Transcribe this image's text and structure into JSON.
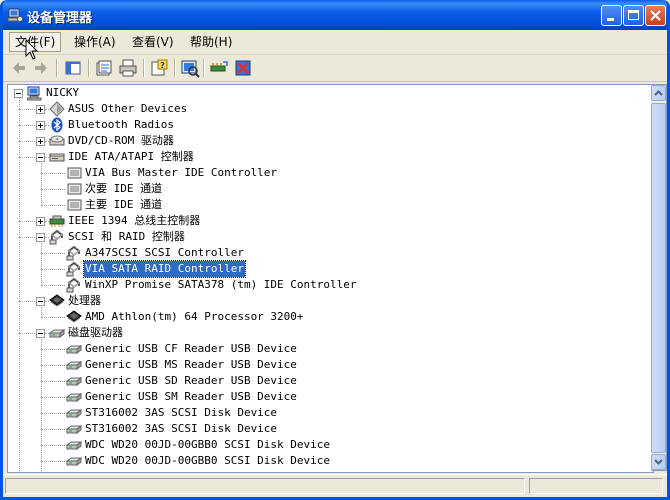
{
  "window": {
    "title": "设备管理器"
  },
  "menu": [
    {
      "label": "文件(F)",
      "active": true
    },
    {
      "label": "操作(A)"
    },
    {
      "label": "查看(V)"
    },
    {
      "label": "帮助(H)"
    }
  ],
  "toolbar": {
    "icons": [
      "back-icon",
      "forward-icon",
      "show-hide-console-tree-icon",
      "properties-icon",
      "print-icon",
      "help-icon",
      "scan-hardware-icon",
      "update-driver-icon",
      "uninstall-icon"
    ]
  },
  "tree": {
    "root": "NICKY",
    "items": [
      {
        "label": "ASUS Other Devices",
        "icon": "other-devices-icon",
        "level": 1,
        "expander": "plus"
      },
      {
        "label": "Bluetooth Radios",
        "icon": "bluetooth-icon",
        "level": 1,
        "expander": "plus"
      },
      {
        "label": "DVD/CD-ROM 驱动器",
        "icon": "cdrom-icon",
        "level": 1,
        "expander": "plus"
      },
      {
        "label": "IDE ATA/ATAPI 控制器",
        "icon": "ide-controller-icon",
        "level": 1,
        "expander": "minus"
      },
      {
        "label": "VIA Bus Master IDE Controller",
        "icon": "ide-channel-icon",
        "level": 2
      },
      {
        "label": "次要 IDE 通道",
        "icon": "ide-channel-icon",
        "level": 2
      },
      {
        "label": "主要 IDE 通道",
        "icon": "ide-channel-icon",
        "level": 2
      },
      {
        "label": "IEEE 1394 总线主控制器",
        "icon": "ieee1394-icon",
        "level": 1,
        "expander": "plus"
      },
      {
        "label": "SCSI 和 RAID 控制器",
        "icon": "scsi-icon",
        "level": 1,
        "expander": "minus"
      },
      {
        "label": "A347SCSI SCSI Controller",
        "icon": "scsi-icon",
        "level": 2
      },
      {
        "label": "VIA SATA RAID Controller",
        "icon": "scsi-icon",
        "level": 2,
        "selected": true
      },
      {
        "label": "WinXP Promise SATA378 (tm) IDE Controller",
        "icon": "scsi-icon",
        "level": 2
      },
      {
        "label": "处理器",
        "icon": "processor-icon",
        "level": 1,
        "expander": "minus"
      },
      {
        "label": "AMD Athlon(tm) 64 Processor 3200+",
        "icon": "processor-icon",
        "level": 2
      },
      {
        "label": "磁盘驱动器",
        "icon": "disk-drive-icon",
        "level": 1,
        "expander": "minus"
      },
      {
        "label": "Generic USB CF Reader USB Device",
        "icon": "disk-drive-icon",
        "level": 2
      },
      {
        "label": "Generic USB MS Reader USB Device",
        "icon": "disk-drive-icon",
        "level": 2
      },
      {
        "label": "Generic USB SD Reader USB Device",
        "icon": "disk-drive-icon",
        "level": 2
      },
      {
        "label": "Generic USB SM Reader USB Device",
        "icon": "disk-drive-icon",
        "level": 2
      },
      {
        "label": "ST316002 3AS SCSI Disk Device",
        "icon": "disk-drive-icon",
        "level": 2
      },
      {
        "label": "ST316002 3AS SCSI Disk Device",
        "icon": "disk-drive-icon",
        "level": 2
      },
      {
        "label": "WDC WD20 00JD-00GBB0 SCSI Disk Device",
        "icon": "disk-drive-icon",
        "level": 2
      },
      {
        "label": "WDC WD20 00JD-00GBB0 SCSI Disk Device",
        "icon": "disk-drive-icon",
        "level": 2
      }
    ]
  }
}
